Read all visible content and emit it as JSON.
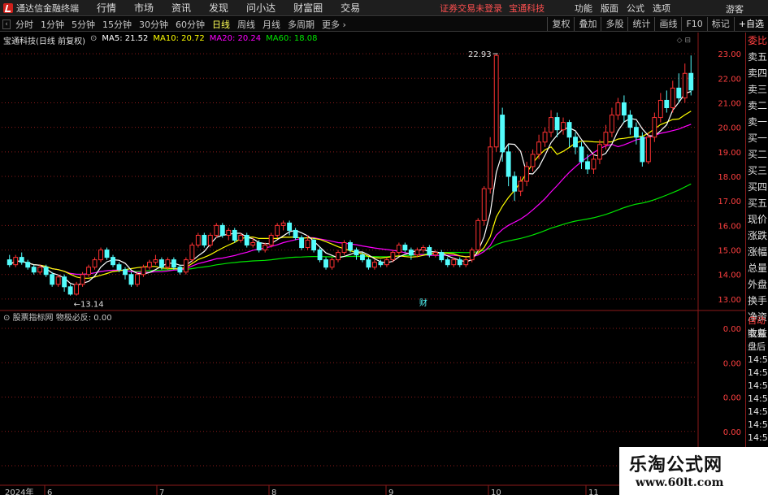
{
  "app": {
    "title": "通达信金融终端"
  },
  "menu": {
    "items": [
      "行情",
      "市场",
      "资讯",
      "发现",
      "问小达",
      "财富圈",
      "交易"
    ]
  },
  "notices": {
    "trade": "证券交易未登录",
    "stock": "宝通科技"
  },
  "right_menu": {
    "items": [
      "功能",
      "版面",
      "公式",
      "选项"
    ],
    "guest": "游客"
  },
  "period_tabs": {
    "items": [
      "分时",
      "1分钟",
      "5分钟",
      "15分钟",
      "30分钟",
      "60分钟",
      "日线",
      "周线",
      "月线",
      "多周期",
      "更多 ›"
    ],
    "active": "日线"
  },
  "tool_buttons": [
    "复权",
    "叠加",
    "多股",
    "统计",
    "画线",
    "F10",
    "标记",
    "+自选"
  ],
  "legend": {
    "stock": "宝通科技(日线 前复权)",
    "ma5": "MA5: 21.52",
    "ma10": "MA10: 20.72",
    "ma20": "MA20: 20.24",
    "ma60": "MA60: 18.08"
  },
  "indicator_legend": "股票指标网  物极必反: 0.00",
  "quote_panel": {
    "upper": [
      "委比",
      "卖五",
      "卖四",
      "卖三",
      "卖二",
      "卖一",
      "买一",
      "买二",
      "买三",
      "买四",
      "买五",
      "现价",
      "涨跌",
      "涨幅",
      "总量",
      "外盘",
      "换手",
      "净资",
      "收益"
    ],
    "lower": [
      "自动",
      "交易",
      "盘后",
      "14:5",
      "14:5",
      "14:5",
      "14:5",
      "14:5",
      "14:5",
      "14:5",
      "14:5"
    ]
  },
  "watermark": {
    "title": "乐淘公式网",
    "url": "www.60lt.com"
  },
  "colors": {
    "up": "#ff3232",
    "down": "#54fcfc",
    "ma5": "#ffffff",
    "ma10": "#ffff00",
    "ma20": "#ff00ff",
    "ma60": "#00e600",
    "grid": "#8b1a1a"
  },
  "chart_data": {
    "type": "candlestick",
    "y_ticks": [
      13.0,
      14.0,
      15.0,
      16.0,
      17.0,
      18.0,
      19.0,
      20.0,
      21.0,
      22.0,
      23.0
    ],
    "ylim": [
      12.6,
      23.6
    ],
    "indicator_ticks": [
      "0.00",
      "0.00",
      "0.00",
      "0.00",
      "0.00"
    ],
    "x_ticks": [
      "2024年",
      "6",
      "7",
      "8",
      "9",
      "10",
      "11"
    ],
    "annotations": {
      "high": "22.93",
      "low": "←13.14",
      "event_marker": "财"
    },
    "candles": [
      [
        14.6,
        14.4,
        14.8,
        14.3
      ],
      [
        14.4,
        14.7,
        14.8,
        14.3
      ],
      [
        14.7,
        14.5,
        14.9,
        14.4
      ],
      [
        14.5,
        14.3,
        14.6,
        14.2
      ],
      [
        14.3,
        14.1,
        14.4,
        14.0
      ],
      [
        14.1,
        14.3,
        14.4,
        14.0
      ],
      [
        14.3,
        14.0,
        14.4,
        13.9
      ],
      [
        14.0,
        13.6,
        14.1,
        13.5
      ],
      [
        13.6,
        13.9,
        14.0,
        13.5
      ],
      [
        13.9,
        13.5,
        14.0,
        13.3
      ],
      [
        13.5,
        13.2,
        13.6,
        13.14
      ],
      [
        13.2,
        13.6,
        13.7,
        13.14
      ],
      [
        13.6,
        14.0,
        14.1,
        13.5
      ],
      [
        14.0,
        14.3,
        14.4,
        13.9
      ],
      [
        14.3,
        14.6,
        14.7,
        14.2
      ],
      [
        14.6,
        15.0,
        15.1,
        14.5
      ],
      [
        15.0,
        14.7,
        15.1,
        14.6
      ],
      [
        14.7,
        14.4,
        14.8,
        14.3
      ],
      [
        14.4,
        14.2,
        14.5,
        14.1
      ],
      [
        14.2,
        14.0,
        14.3,
        13.8
      ],
      [
        14.0,
        13.6,
        14.1,
        13.5
      ],
      [
        13.6,
        14.0,
        14.1,
        13.5
      ],
      [
        14.0,
        14.3,
        14.4,
        13.9
      ],
      [
        14.3,
        14.5,
        14.6,
        14.2
      ],
      [
        14.5,
        14.6,
        14.8,
        14.4
      ],
      [
        14.6,
        14.3,
        14.7,
        14.2
      ],
      [
        14.3,
        14.6,
        14.7,
        14.2
      ],
      [
        14.6,
        14.3,
        14.7,
        14.2
      ],
      [
        14.3,
        14.1,
        14.4,
        14.0
      ],
      [
        14.1,
        14.6,
        14.7,
        14.0
      ],
      [
        14.6,
        15.2,
        15.3,
        14.5
      ],
      [
        15.2,
        15.6,
        15.7,
        15.1
      ],
      [
        15.6,
        15.2,
        15.7,
        15.1
      ],
      [
        15.2,
        15.6,
        15.7,
        15.1
      ],
      [
        15.6,
        16.0,
        16.1,
        15.5
      ],
      [
        16.0,
        15.6,
        16.1,
        15.5
      ],
      [
        15.6,
        15.8,
        15.9,
        15.4
      ],
      [
        15.8,
        15.4,
        15.9,
        15.3
      ],
      [
        15.4,
        15.6,
        15.7,
        15.3
      ],
      [
        15.6,
        15.2,
        15.7,
        15.1
      ],
      [
        15.2,
        15.3,
        15.5,
        15.1
      ],
      [
        15.3,
        15.0,
        15.4,
        14.9
      ],
      [
        15.0,
        15.2,
        15.3,
        14.9
      ],
      [
        15.2,
        15.6,
        15.7,
        15.1
      ],
      [
        15.6,
        16.0,
        16.1,
        15.5
      ],
      [
        16.0,
        16.1,
        16.2,
        15.8
      ],
      [
        16.1,
        15.8,
        16.2,
        15.6
      ],
      [
        15.8,
        15.5,
        15.9,
        15.4
      ],
      [
        15.5,
        15.1,
        15.6,
        15.0
      ],
      [
        15.1,
        15.4,
        15.6,
        15.0
      ],
      [
        15.4,
        15.0,
        15.5,
        14.9
      ],
      [
        15.0,
        14.6,
        15.1,
        14.5
      ],
      [
        14.6,
        14.3,
        14.7,
        14.2
      ],
      [
        14.3,
        14.6,
        14.7,
        14.2
      ],
      [
        14.6,
        14.9,
        15.0,
        14.5
      ],
      [
        14.9,
        15.3,
        15.4,
        14.8
      ],
      [
        15.3,
        15.0,
        15.4,
        14.9
      ],
      [
        15.0,
        14.8,
        15.1,
        14.6
      ],
      [
        14.8,
        14.6,
        14.9,
        14.5
      ],
      [
        14.6,
        14.3,
        14.7,
        14.2
      ],
      [
        14.3,
        14.5,
        14.6,
        14.2
      ],
      [
        14.5,
        14.4,
        14.6,
        14.3
      ],
      [
        14.4,
        14.6,
        14.7,
        14.3
      ],
      [
        14.6,
        14.9,
        15.0,
        14.5
      ],
      [
        14.9,
        15.2,
        15.3,
        14.8
      ],
      [
        15.2,
        15.0,
        15.3,
        14.9
      ],
      [
        15.0,
        14.8,
        15.1,
        14.6
      ],
      [
        14.8,
        15.0,
        15.1,
        14.7
      ],
      [
        15.0,
        15.1,
        15.2,
        14.9
      ],
      [
        15.1,
        14.8,
        15.2,
        14.7
      ],
      [
        14.8,
        14.9,
        15.0,
        14.7
      ],
      [
        14.9,
        14.6,
        15.0,
        14.5
      ],
      [
        14.6,
        14.4,
        14.7,
        14.3
      ],
      [
        14.4,
        14.6,
        14.7,
        14.3
      ],
      [
        14.6,
        14.4,
        14.7,
        14.3
      ],
      [
        14.4,
        14.6,
        14.7,
        14.3
      ],
      [
        14.6,
        15.0,
        15.1,
        14.5
      ],
      [
        15.0,
        16.2,
        16.3,
        14.9
      ],
      [
        16.2,
        17.5,
        17.6,
        16.0
      ],
      [
        17.5,
        19.2,
        19.6,
        17.3
      ],
      [
        19.2,
        22.93,
        23.0,
        19.0
      ],
      [
        20.5,
        19.0,
        20.8,
        18.6
      ],
      [
        19.0,
        18.0,
        19.3,
        17.6
      ],
      [
        18.0,
        17.4,
        18.2,
        17.0
      ],
      [
        17.4,
        17.8,
        18.0,
        17.2
      ],
      [
        17.8,
        18.4,
        18.6,
        17.6
      ],
      [
        18.4,
        18.9,
        19.1,
        18.2
      ],
      [
        18.9,
        19.4,
        19.7,
        18.7
      ],
      [
        19.4,
        19.8,
        20.0,
        19.2
      ],
      [
        19.8,
        20.4,
        20.7,
        19.6
      ],
      [
        20.4,
        19.9,
        20.6,
        19.6
      ],
      [
        19.9,
        20.2,
        20.4,
        19.7
      ],
      [
        20.2,
        19.6,
        20.3,
        19.2
      ],
      [
        19.6,
        19.2,
        19.8,
        18.9
      ],
      [
        19.2,
        18.6,
        19.4,
        18.3
      ],
      [
        18.6,
        18.3,
        18.9,
        18.1
      ],
      [
        18.3,
        18.7,
        18.9,
        18.1
      ],
      [
        18.7,
        19.3,
        19.5,
        18.5
      ],
      [
        19.3,
        19.8,
        20.1,
        19.1
      ],
      [
        19.8,
        20.5,
        20.8,
        19.6
      ],
      [
        20.5,
        21.0,
        21.2,
        20.3
      ],
      [
        21.0,
        20.5,
        21.3,
        20.2
      ],
      [
        20.5,
        20.0,
        20.7,
        19.7
      ],
      [
        20.0,
        19.6,
        20.2,
        19.3
      ],
      [
        19.6,
        18.6,
        19.8,
        18.4
      ],
      [
        18.6,
        19.6,
        19.8,
        18.5
      ],
      [
        19.6,
        20.4,
        20.6,
        19.4
      ],
      [
        20.4,
        21.1,
        21.4,
        20.2
      ],
      [
        21.1,
        20.8,
        21.5,
        20.6
      ],
      [
        20.8,
        21.6,
        21.9,
        20.6
      ],
      [
        21.6,
        21.2,
        22.2,
        21.0
      ],
      [
        21.2,
        22.2,
        22.6,
        21.0
      ],
      [
        22.2,
        21.52,
        22.93,
        21.3
      ]
    ]
  }
}
